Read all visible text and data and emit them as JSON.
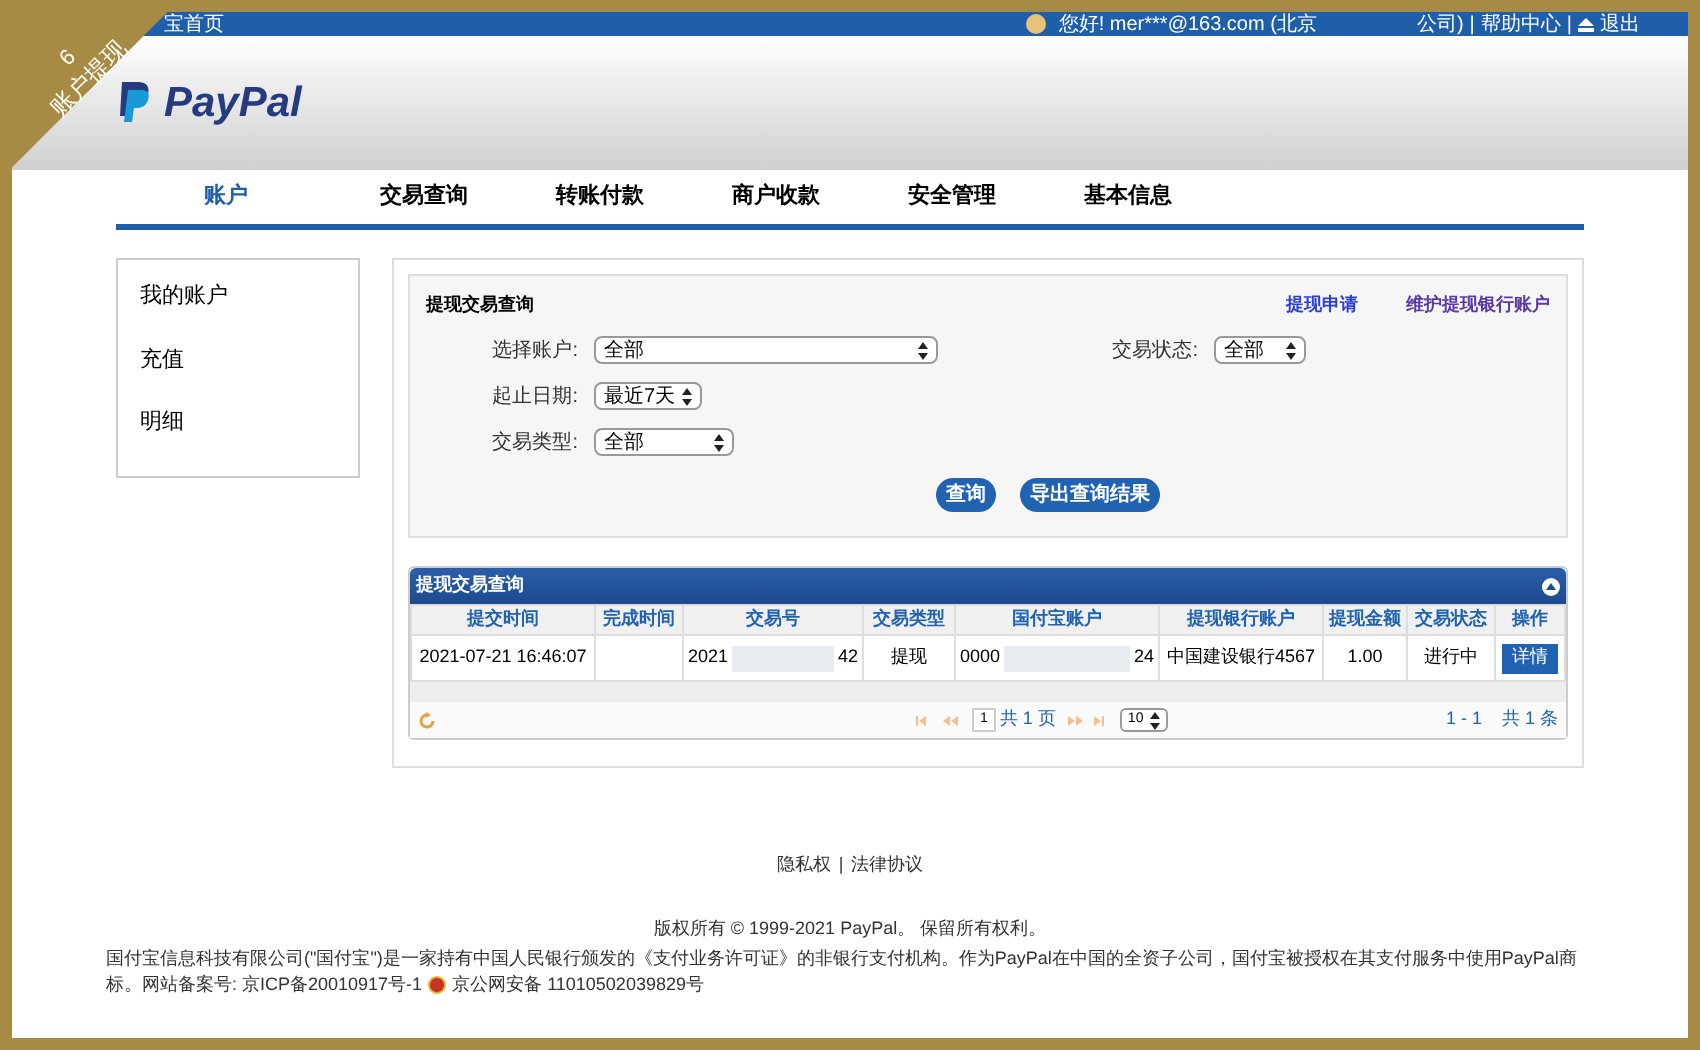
{
  "corner_ribbon": {
    "number": "6",
    "title": "账户提现"
  },
  "top_bar": {
    "home_link": "宝首页",
    "greeting": "您好! mer***@163.com (北京",
    "greeting_end": "公司)",
    "links": [
      "帮助中心",
      "退出"
    ],
    "separator": "|"
  },
  "header": {
    "logo_text": "PayPal"
  },
  "nav_tabs": [
    {
      "label": "账户",
      "selected": true
    },
    {
      "label": "交易查询",
      "selected": false
    },
    {
      "label": "转账付款",
      "selected": false
    },
    {
      "label": "商户收款",
      "selected": false
    },
    {
      "label": "安全管理",
      "selected": false
    },
    {
      "label": "基本信息",
      "selected": false
    }
  ],
  "sidebar": {
    "items": [
      "我的账户",
      "充值",
      "明细"
    ]
  },
  "query_panel": {
    "title": "提现交易查询",
    "links": [
      "提现申请",
      "维护提现银行账户"
    ],
    "fields": [
      {
        "label": "选择账户:",
        "value": "全部"
      },
      {
        "label": "交易状态:",
        "value": "全部"
      },
      {
        "label": "起止日期:",
        "value": "最近7天"
      },
      {
        "label": "交易类型:",
        "value": "全部"
      }
    ],
    "buttons": [
      "查询",
      "导出查询结果"
    ]
  },
  "results": {
    "title": "提现交易查询",
    "columns": [
      "提交时间",
      "完成时间",
      "交易号",
      "交易类型",
      "国付宝账户",
      "提现银行账户",
      "提现金额",
      "交易状态",
      "操作"
    ],
    "rows": [
      {
        "submit_time": "2021-07-21 16:46:07",
        "trade_no": {
          "start": "2021",
          "end": "42"
        },
        "type": "提现",
        "account": {
          "start": "0000",
          "end": "24"
        },
        "bank_account": "中国建设银行4567",
        "amount": "1.00",
        "status": "进行中",
        "action": "详情"
      }
    ],
    "pager": {
      "page": "1",
      "total_pages": "共 1 页",
      "page_size": "10",
      "range": "1 - 1",
      "total": "共 1 条"
    }
  },
  "footer": {
    "links": [
      "隐私权",
      "法律协议"
    ],
    "separator": "|",
    "copyright": "版权所有 © 1999-2021 PayPal。 保留所有权利。",
    "notice_lines": [
      "国付宝信息科技有限公司(\"国付宝\")是一家持有中国人民银行颁发的《支付业务许可证》的非银行支付机构。作为PayPal在中国的全资子公司，国付宝被授权在其支付服务中使用PayPal商",
      "标。网站备案号:  京ICP备20010917号-1"
    ],
    "police_record": "京公网安备 11010502039829号"
  }
}
